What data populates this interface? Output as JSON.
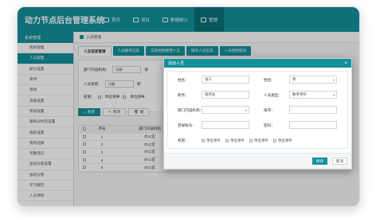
{
  "app": {
    "title": "动力节点后台管理系统"
  },
  "nav": [
    {
      "label": "首页",
      "icon": "home-icon"
    },
    {
      "label": "项目",
      "icon": "project-icon"
    },
    {
      "label": "数据统计",
      "icon": "chart-icon"
    },
    {
      "label": "管理",
      "icon": "manage-icon"
    }
  ],
  "sidebar": {
    "header": "系统管理",
    "items": [
      {
        "label": "机构管理"
      },
      {
        "label": "人员管理"
      },
      {
        "label": "职位设置"
      },
      {
        "label": "审评"
      },
      {
        "label": "测试"
      },
      {
        "label": "高级设置"
      },
      {
        "label": "考核设置"
      },
      {
        "label": "随和分析的设置"
      },
      {
        "label": "指标设置"
      },
      {
        "label": "机构选择"
      },
      {
        "label": "考勤登记"
      },
      {
        "label": "加班分类设置"
      },
      {
        "label": "加班分管"
      },
      {
        "label": "学习报告"
      },
      {
        "label": "人员调动"
      }
    ]
  },
  "breadcrumb": {
    "text": "人员管理"
  },
  "tabs": [
    "人员信息管理",
    "人员报考信息",
    "实际控制使用人员",
    "操作人员信息",
    "人员控制培训"
  ],
  "filters": {
    "dept_label": "部门内设机构：",
    "dept_value": "冷静",
    "dept_more": "请",
    "name_label": "人员名称：",
    "name_value": "冷静",
    "name_more": "职",
    "permission_label": "权限：",
    "permission_options": [
      "单位领导",
      "单位领导"
    ]
  },
  "actions": {
    "add": "新建",
    "edit": "修改",
    "delete": "删"
  },
  "table": {
    "headers": [
      "",
      "序号",
      "部门内设机构",
      "",
      "",
      "",
      "",
      ""
    ],
    "rows": [
      {
        "no": "1",
        "dept": "办公室",
        "c3": "",
        "c4": "",
        "gender": "",
        "c6": "",
        "c7": ""
      },
      {
        "no": "2",
        "dept": "办公室",
        "c3": "",
        "c4": "",
        "gender": "",
        "c6": "",
        "c7": ""
      },
      {
        "no": "3",
        "dept": "办公室",
        "c3": "",
        "c4": "",
        "gender": "",
        "c6": "",
        "c7": ""
      },
      {
        "no": "4",
        "dept": "办公室",
        "c3": "",
        "c4": "",
        "gender": "",
        "c6": "",
        "c7": ""
      },
      {
        "no": "5",
        "dept": "办公室",
        "c3": "admin",
        "c4": "admin",
        "gender": "女",
        "c6": "总经理",
        "c7": "为规定"
      }
    ]
  },
  "modal": {
    "title": "添加人员",
    "close": "×",
    "fields": {
      "name_label": "姓名：",
      "name_value": "张三",
      "gender_label": "性别：",
      "gender_value": "男",
      "position_label": "职务：",
      "position_value": "程序员",
      "type_label": "人员类型：",
      "type_value": "敏考领导",
      "dept_label": "部门内设机构：",
      "dept_value": "",
      "order_label": "排序：",
      "order_value": "",
      "login_label": "登录账号：",
      "login_value": "",
      "password_label": "密码：",
      "password_value": "",
      "permission_label": "权限："
    },
    "permissions": [
      "单位领导",
      "单位领导",
      "单位领导",
      "单位领导"
    ],
    "save": "保存",
    "cancel": "取消"
  }
}
